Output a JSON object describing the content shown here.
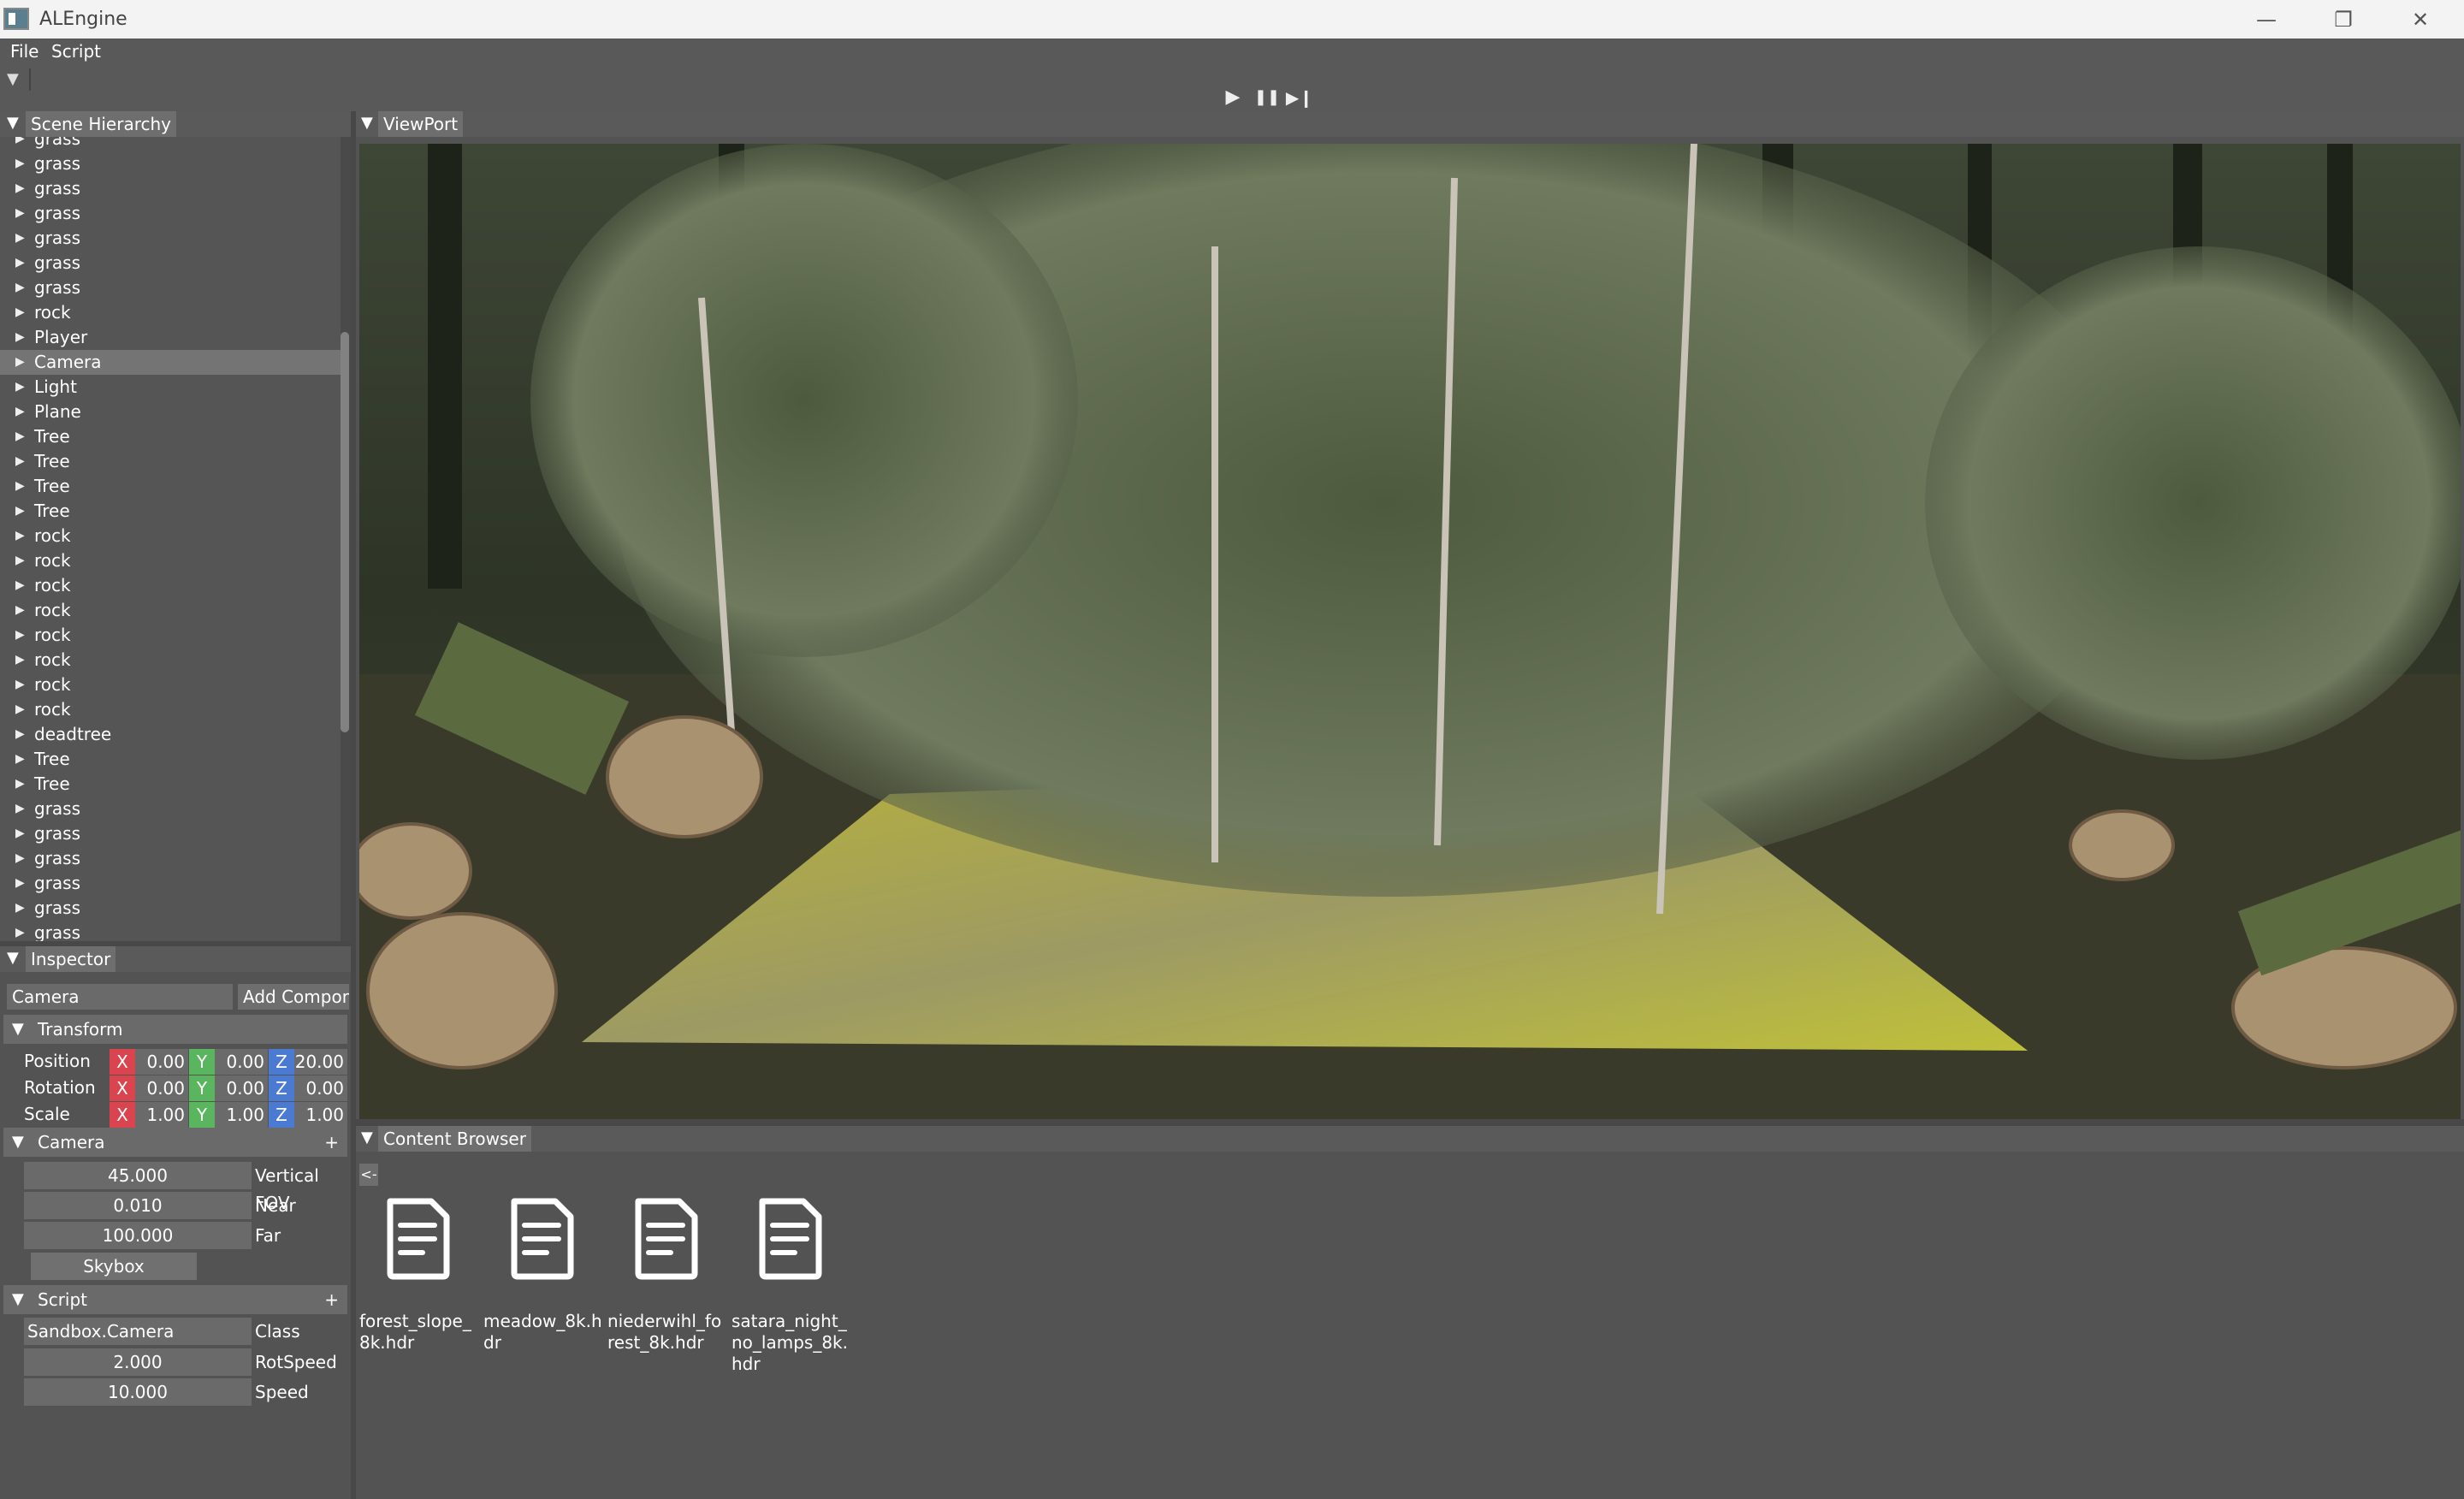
{
  "window": {
    "title": "ALEngine",
    "minimize": "—",
    "restore": "❐",
    "close": "✕"
  },
  "menu": [
    "File",
    "Script"
  ],
  "toolbar": {
    "play": "▶",
    "pause": "❚❚",
    "step": "▶❙"
  },
  "scene_hierarchy": {
    "title": "Scene Hierarchy",
    "items": [
      "grass",
      "grass",
      "grass",
      "grass",
      "grass",
      "grass",
      "grass",
      "rock",
      "Player",
      "Camera",
      "Light",
      "Plane",
      "Tree",
      "Tree",
      "Tree",
      "Tree",
      "rock",
      "rock",
      "rock",
      "rock",
      "rock",
      "rock",
      "rock",
      "rock",
      "deadtree",
      "Tree",
      "Tree",
      "grass",
      "grass",
      "grass",
      "grass",
      "grass",
      "grass"
    ],
    "selected": "Camera"
  },
  "viewport": {
    "title": "ViewPort"
  },
  "inspector": {
    "title": "Inspector",
    "object_name": "Camera",
    "add_component": "Add Component",
    "transform": {
      "title": "Transform",
      "rows": [
        {
          "label": "Position",
          "x": "0.00",
          "y": "0.00",
          "z": "20.00"
        },
        {
          "label": "Rotation",
          "x": "0.00",
          "y": "0.00",
          "z": "0.00"
        },
        {
          "label": "Scale",
          "x": "1.00",
          "y": "1.00",
          "z": "1.00"
        }
      ],
      "axes": {
        "x": "X",
        "y": "Y",
        "z": "Z"
      }
    },
    "camera": {
      "title": "Camera",
      "add": "+",
      "fields": [
        {
          "value": "45.000",
          "label": "Vertical FOV"
        },
        {
          "value": "0.010",
          "label": "Near"
        },
        {
          "value": "100.000",
          "label": "Far"
        }
      ],
      "skybox": "Skybox"
    },
    "script": {
      "title": "Script",
      "add": "+",
      "class_value": "Sandbox.Camera",
      "class_label": "Class",
      "fields": [
        {
          "value": "2.000",
          "label": "RotSpeed"
        },
        {
          "value": "10.000",
          "label": "Speed"
        }
      ]
    }
  },
  "content_browser": {
    "title": "Content Browser",
    "back": "<-",
    "files": [
      "forest_slope_8k.hdr",
      "meadow_8k.hdr",
      "niederwihl_forest_8k.hdr",
      "satara_night_no_lamps_8k.hdr"
    ]
  },
  "colors": {
    "axis_x": "#d9444f",
    "axis_y": "#59b65e",
    "axis_z": "#4a7ad2",
    "panel": "#535353",
    "selected": "#747474"
  }
}
